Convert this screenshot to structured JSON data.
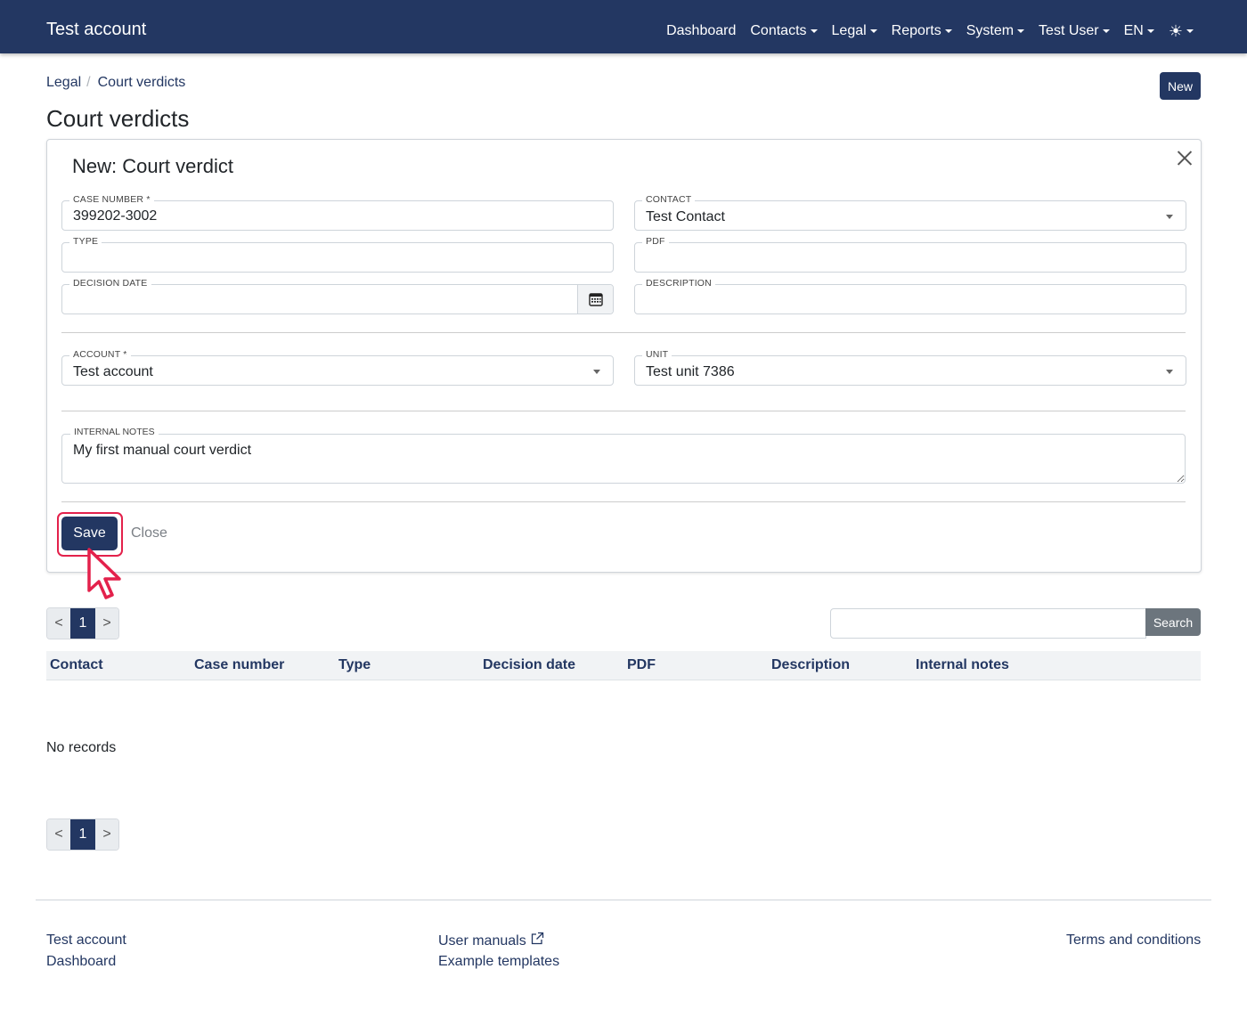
{
  "navbar": {
    "brand": "Test account",
    "items": [
      {
        "label": "Dashboard",
        "dropdown": false
      },
      {
        "label": "Contacts",
        "dropdown": true
      },
      {
        "label": "Legal",
        "dropdown": true
      },
      {
        "label": "Reports",
        "dropdown": true
      },
      {
        "label": "System",
        "dropdown": true
      },
      {
        "label": "Test User",
        "dropdown": true
      },
      {
        "label": "EN",
        "dropdown": true
      }
    ],
    "theme_icon": "sun-icon"
  },
  "breadcrumb": [
    "Legal",
    "Court verdicts"
  ],
  "new_button": "New",
  "page_title": "Court verdicts",
  "form": {
    "title": "New: Court verdict",
    "case_number": {
      "label": "CASE NUMBER *",
      "value": "399202-3002"
    },
    "contact": {
      "label": "CONTACT",
      "value": "Test Contact"
    },
    "type": {
      "label": "TYPE",
      "value": ""
    },
    "pdf": {
      "label": "PDF",
      "value": ""
    },
    "decision_date": {
      "label": "DECISION DATE",
      "value": ""
    },
    "description": {
      "label": "DESCRIPTION",
      "value": ""
    },
    "account": {
      "label": "ACCOUNT *",
      "value": "Test account"
    },
    "unit": {
      "label": "UNIT",
      "value": "Test unit 7386"
    },
    "internal_notes": {
      "label": "INTERNAL NOTES",
      "value": "My first manual court verdict"
    },
    "save_label": "Save",
    "close_label": "Close"
  },
  "pagination": {
    "prev": "<",
    "current": "1",
    "next": ">"
  },
  "search": {
    "placeholder": "",
    "button": "Search"
  },
  "table": {
    "columns": [
      "Contact",
      "Case number",
      "Type",
      "Decision date",
      "PDF",
      "Description",
      "Internal notes"
    ],
    "empty_text": "No records"
  },
  "footer": {
    "col1": [
      "Test account",
      "Dashboard"
    ],
    "col2": [
      "User manuals",
      "Example templates"
    ],
    "col3": [
      "Terms and conditions"
    ]
  },
  "colors": {
    "primary": "#233762",
    "highlight": "#e3214b",
    "secondary": "#6c757d"
  }
}
